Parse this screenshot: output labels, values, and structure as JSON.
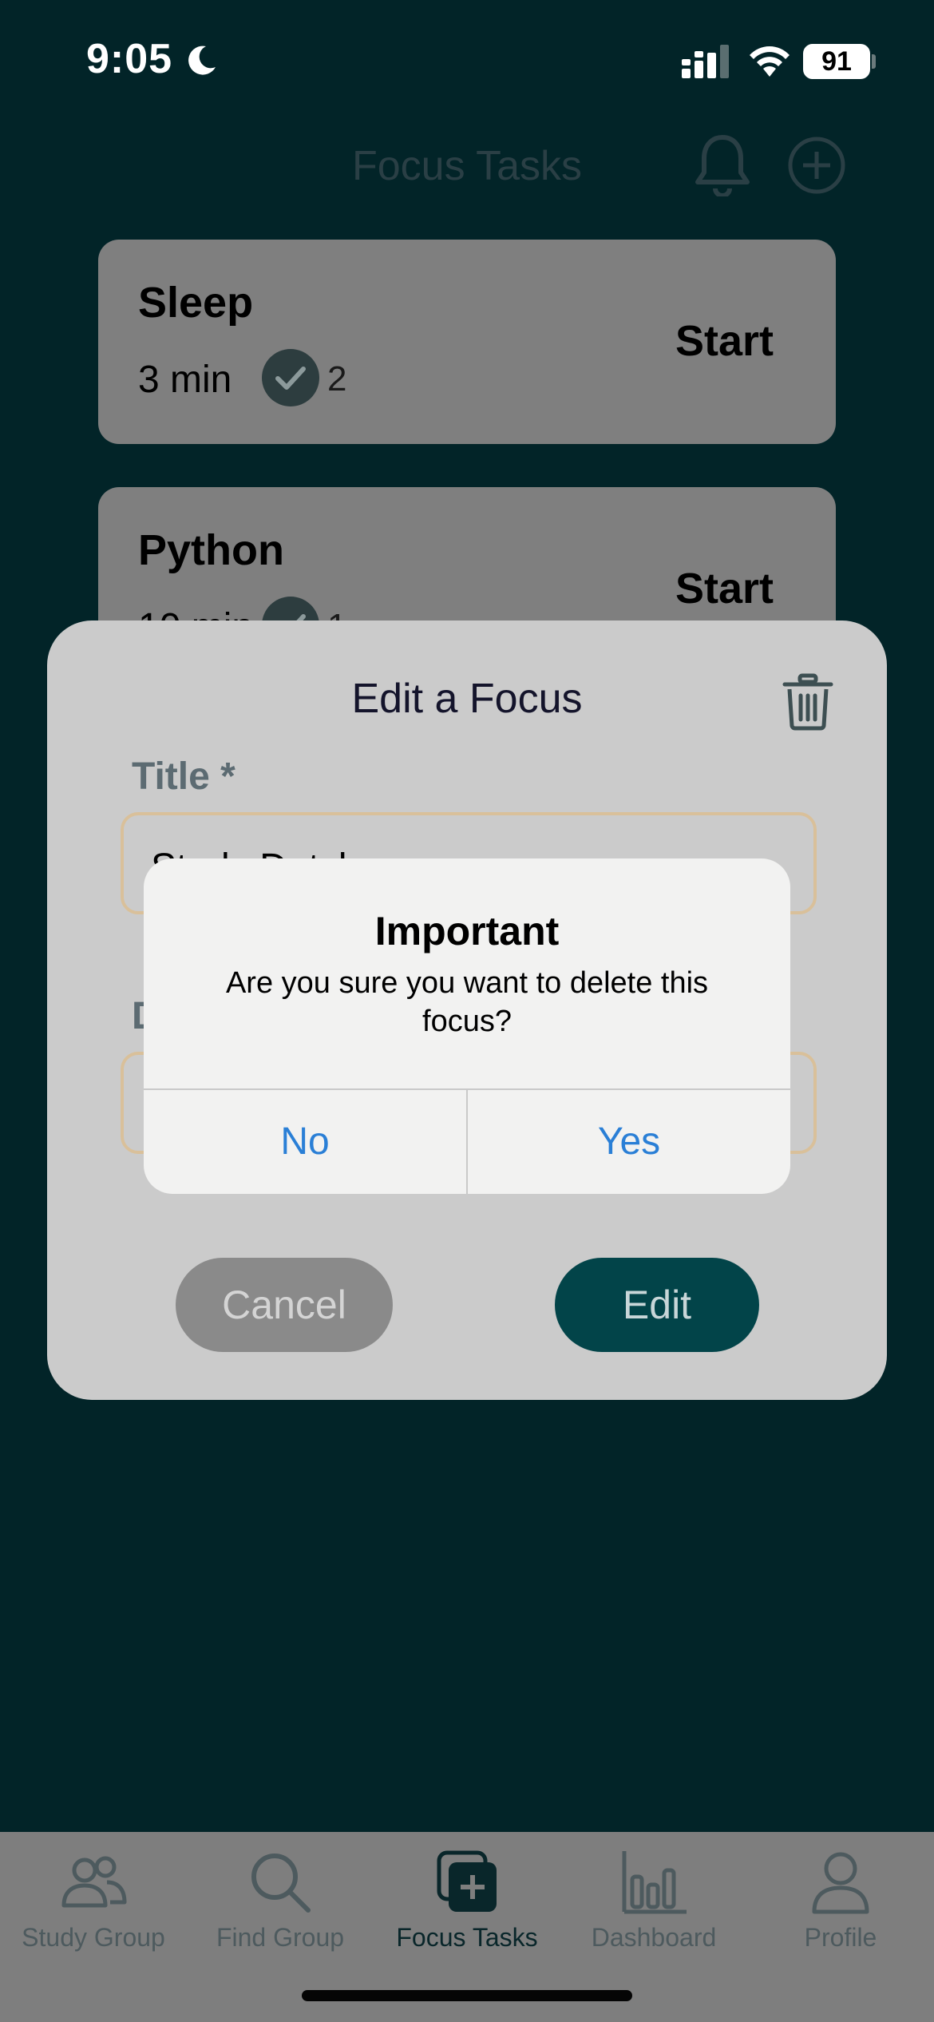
{
  "status_bar": {
    "time": "9:05",
    "battery": "91"
  },
  "header": {
    "title": "Focus Tasks"
  },
  "tasks": [
    {
      "title": "Sleep",
      "duration": "3 min",
      "completed_count": "2",
      "action": "Start"
    },
    {
      "title": "Python",
      "duration": "10 min",
      "completed_count": "1",
      "action": "Start"
    }
  ],
  "edit_sheet": {
    "title": "Edit a Focus",
    "title_label": "Title *",
    "title_value": "Study Dutch",
    "description_label": "D",
    "description_value": "",
    "cancel_label": "Cancel",
    "edit_label": "Edit"
  },
  "alert": {
    "title": "Important",
    "message": "Are you sure you want to delete this focus?",
    "no_label": "No",
    "yes_label": "Yes"
  },
  "tab_bar": {
    "items": [
      {
        "label": "Study Group",
        "icon": "people-icon"
      },
      {
        "label": "Find Group",
        "icon": "search-icon"
      },
      {
        "label": "Focus Tasks",
        "icon": "focus-tasks-icon",
        "active": true
      },
      {
        "label": "Dashboard",
        "icon": "bar-chart-icon"
      },
      {
        "label": "Profile",
        "icon": "person-icon"
      }
    ]
  },
  "colors": {
    "background": "#022428",
    "accent": "#024449",
    "alert_button": "#2a7fd6",
    "field_border": "#d9c09a"
  }
}
